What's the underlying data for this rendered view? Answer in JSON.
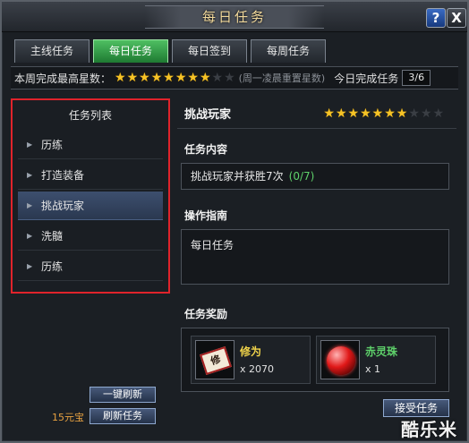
{
  "window": {
    "title": "每日任务",
    "help_label": "?",
    "close_label": "X"
  },
  "tabs": [
    {
      "label": "主线任务",
      "active": false
    },
    {
      "label": "每日任务",
      "active": true
    },
    {
      "label": "每日签到",
      "active": false
    },
    {
      "label": "每周任务",
      "active": false
    }
  ],
  "status": {
    "max_stars_label": "本周完成最高星数：",
    "max_stars": 8,
    "max_stars_total": 10,
    "reset_note": "(周一凌晨重置星数)",
    "today_label": "今日完成任务",
    "today_count": "3/6"
  },
  "task_list": {
    "header": "任务列表",
    "items": [
      {
        "label": "历练",
        "selected": false
      },
      {
        "label": "打造装备",
        "selected": false
      },
      {
        "label": "挑战玩家",
        "selected": true
      },
      {
        "label": "洗髓",
        "selected": false
      },
      {
        "label": "历练",
        "selected": false
      }
    ]
  },
  "left_buttons": {
    "refresh_one": "一键刷新",
    "refresh_task": "刷新任务",
    "cost": "15元宝"
  },
  "detail": {
    "task_name": "挑战玩家",
    "stars": 7,
    "stars_total": 10,
    "content_label": "任务内容",
    "content_text": "挑战玩家并获胜7次",
    "content_progress": "(0/7)",
    "guide_label": "操作指南",
    "guide_text": "每日任务",
    "reward_label": "任务奖励",
    "rewards": [
      {
        "name": "修为",
        "qty": "x 2070",
        "icon": "cultivation-scroll-icon",
        "icon_glyph": "修",
        "color": "#f0d34a"
      },
      {
        "name": "赤灵珠",
        "qty": "x 1",
        "icon": "red-orb-icon",
        "color": "#5ed16a"
      }
    ],
    "accept_label": "接受任务"
  },
  "watermark": "酷乐米"
}
